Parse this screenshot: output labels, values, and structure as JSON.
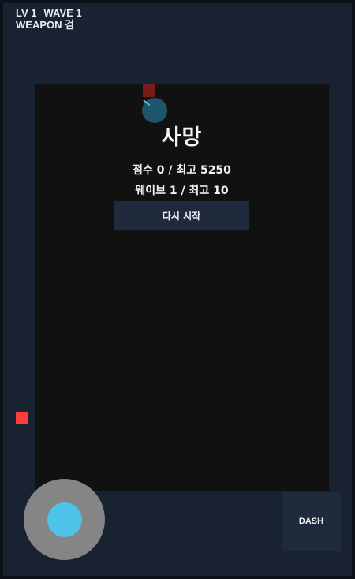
{
  "hud": {
    "level": "LV 1",
    "wave": "WAVE 1",
    "weapon": "WEAPON 검"
  },
  "game_over": {
    "title": "사망",
    "score_line": "점수 0 / 최고 5250",
    "wave_line": "웨이브 1 / 최고 10",
    "restart_label": "다시 시작"
  },
  "controls": {
    "dash_label": "DASH"
  },
  "colors": {
    "background": "#182231",
    "arena": "#111111",
    "enemy": "#ff3b3b",
    "player": "#1f5e76",
    "joystick_base": "#858585",
    "joystick_knob": "#4dc3e8",
    "button": "#1f2a3c"
  }
}
